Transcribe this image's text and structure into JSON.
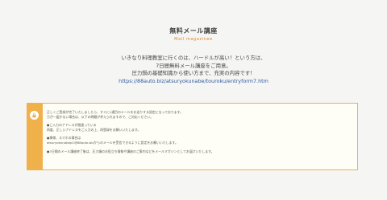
{
  "section": {
    "title": "無料メール講座",
    "subtitle": "Mail magazinee"
  },
  "intro": {
    "line1": "いきなり料理教室に行くのは、ハードルが高い！という方は、",
    "line2": "7日間無料メール講座をご用意。",
    "line3": "圧力鍋の基礎知識から使い方まで、充実の内容です！",
    "link": "https://88auto.biz/atsuryokunabe/touroku/entryform7.htm"
  },
  "notice": {
    "icon": "lock-icon",
    "accent": "#f0b04a",
    "line1": "正しくご登録が完了いたしましたら、すぐに1通目のメールをお送りする設定になっております。",
    "line2": "万が一届かない場合は、以下の問題が考えられますので、ご対応ください。",
    "line3": "●ご入力のアドレスが間違っている",
    "line4": "再度、正しいアドレスをご入力の上、再登録をお願いいたします。",
    "line5": "●携帯、スマホの場合は",
    "line6": "atsuryokunabep1@88auto.bizからのメールを受信できるように設定をお願いいたします。",
    "line7": "●7日間のメール講座終了後は、圧力鍋のお役立ち情報や講座のご案内などをメールマガジンとしてお届けいたします。"
  }
}
